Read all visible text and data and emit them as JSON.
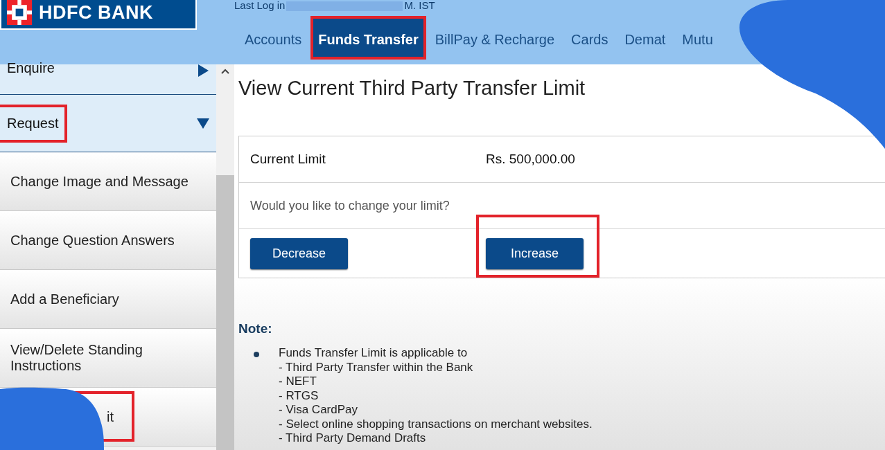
{
  "header": {
    "bank_name": "HDFC BANK",
    "last_login_label": "Last Log in",
    "last_login_suffix": "M. IST"
  },
  "nav_tabs": [
    {
      "label": "Accounts",
      "selected": false,
      "highlighted": false
    },
    {
      "label": "Funds Transfer",
      "selected": true,
      "highlighted": true
    },
    {
      "label": "BillPay & Recharge",
      "selected": false,
      "highlighted": false
    },
    {
      "label": "Cards",
      "selected": false,
      "highlighted": false
    },
    {
      "label": "Demat",
      "selected": false,
      "highlighted": false
    },
    {
      "label": "Mutu",
      "selected": false,
      "highlighted": false
    }
  ],
  "sidebar": {
    "items": [
      {
        "label": "Enquire",
        "kind": "section",
        "expanded": false,
        "highlighted": false
      },
      {
        "label": "Request",
        "kind": "section",
        "expanded": true,
        "highlighted": true
      },
      {
        "label": "Change Image and Message",
        "kind": "link",
        "highlighted": false
      },
      {
        "label": "Change Question Answers",
        "kind": "link",
        "highlighted": false
      },
      {
        "label": "Add a Beneficiary",
        "kind": "link",
        "highlighted": false
      },
      {
        "label": "View/Delete Standing Instructions",
        "kind": "link",
        "highlighted": false
      },
      {
        "label": "it",
        "kind": "link",
        "highlighted": true
      }
    ]
  },
  "page": {
    "title": "View Current Third Party Transfer Limit",
    "limit_label": "Current Limit",
    "limit_value": "Rs. 500,000.00",
    "question": "Would you like to change your limit?",
    "buttons": [
      {
        "label": "Decrease",
        "highlighted": false
      },
      {
        "label": "Increase",
        "highlighted": true
      }
    ],
    "note_heading": "Note:",
    "note_intro": "Funds Transfer Limit is applicable to",
    "note_lines": [
      "- Third Party Transfer within the Bank",
      "- NEFT",
      "- RTGS",
      "- Visa CardPay",
      "- Select online shopping transactions on merchant websites.",
      "- Third Party Demand Drafts"
    ]
  }
}
